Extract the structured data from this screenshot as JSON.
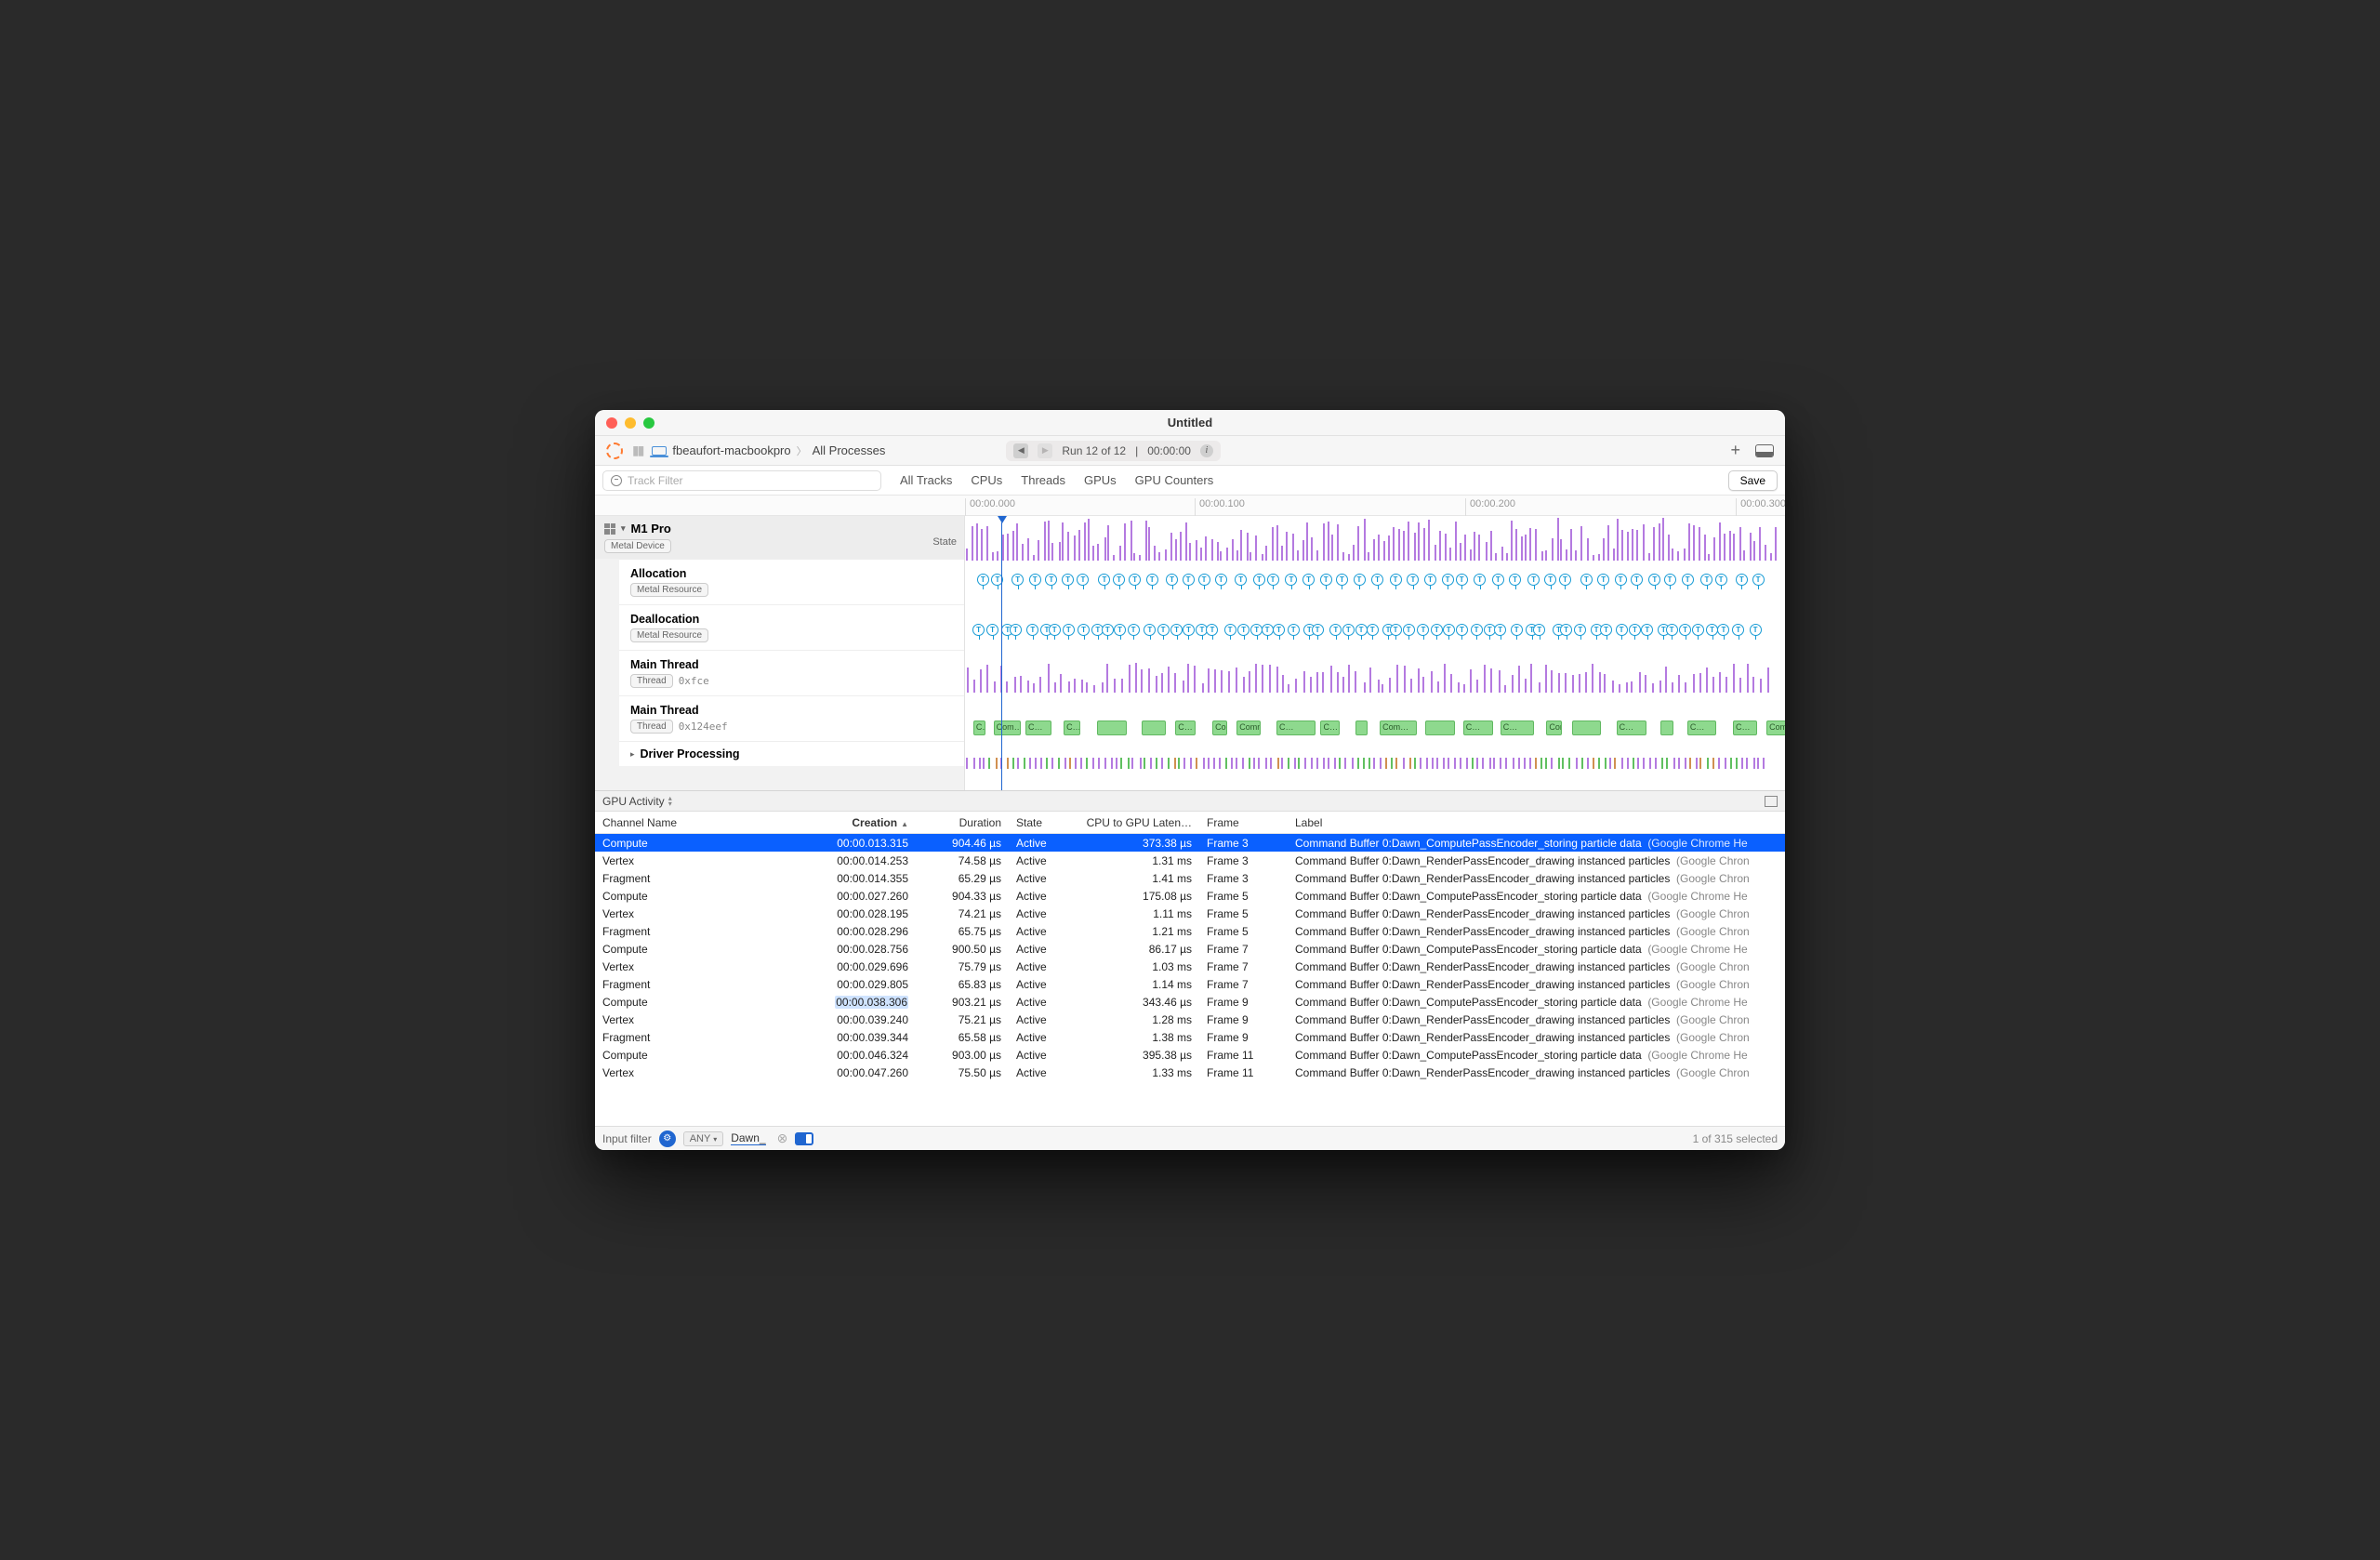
{
  "window": {
    "title": "Untitled"
  },
  "breadcrumb": {
    "host": "fbeaufort-macbookpro",
    "scope": "All Processes"
  },
  "run_pill": {
    "label": "Run 12 of 12",
    "time": "00:00:00"
  },
  "track_filter_placeholder": "Track Filter",
  "tabs": [
    "All Tracks",
    "CPUs",
    "Threads",
    "GPUs",
    "GPU Counters"
  ],
  "save_label": "Save",
  "ruler": [
    "00:00.000",
    "00:00.100",
    "00:00.200",
    "00:00.300"
  ],
  "sidebar": {
    "group": "M1 Pro",
    "group_badge": "Metal Device",
    "state_label": "State",
    "tracks": [
      {
        "name": "Allocation",
        "badge": "Metal Resource"
      },
      {
        "name": "Deallocation",
        "badge": "Metal Resource"
      },
      {
        "name": "Main Thread",
        "badge": "Thread",
        "meta": "0xfce"
      },
      {
        "name": "Main Thread",
        "badge": "Thread",
        "meta": "0x124eef"
      }
    ],
    "driver": "Driver Processing"
  },
  "section": "GPU Activity",
  "columns": {
    "channel": "Channel Name",
    "creation": "Creation",
    "duration": "Duration",
    "state": "State",
    "latency": "CPU to GPU Laten…",
    "frame": "Frame",
    "label": "Label"
  },
  "rows": [
    {
      "ch": "Compute",
      "cr": "00:00.013.315",
      "du": "904.46 µs",
      "st": "Active",
      "la": "373.38 µs",
      "fr": "Frame 3",
      "lb": "Command Buffer 0:Dawn_ComputePassEncoder_storing particle data",
      "app": "(Google Chrome He"
    },
    {
      "ch": "Vertex",
      "cr": "00:00.014.253",
      "du": "74.58 µs",
      "st": "Active",
      "la": "1.31 ms",
      "fr": "Frame 3",
      "lb": "Command Buffer 0:Dawn_RenderPassEncoder_drawing instanced particles",
      "app": "(Google Chron"
    },
    {
      "ch": "Fragment",
      "cr": "00:00.014.355",
      "du": "65.29 µs",
      "st": "Active",
      "la": "1.41 ms",
      "fr": "Frame 3",
      "lb": "Command Buffer 0:Dawn_RenderPassEncoder_drawing instanced particles",
      "app": "(Google Chron"
    },
    {
      "ch": "Compute",
      "cr": "00:00.027.260",
      "du": "904.33 µs",
      "st": "Active",
      "la": "175.08 µs",
      "fr": "Frame 5",
      "lb": "Command Buffer 0:Dawn_ComputePassEncoder_storing particle data",
      "app": "(Google Chrome He"
    },
    {
      "ch": "Vertex",
      "cr": "00:00.028.195",
      "du": "74.21 µs",
      "st": "Active",
      "la": "1.11 ms",
      "fr": "Frame 5",
      "lb": "Command Buffer 0:Dawn_RenderPassEncoder_drawing instanced particles",
      "app": "(Google Chron"
    },
    {
      "ch": "Fragment",
      "cr": "00:00.028.296",
      "du": "65.75 µs",
      "st": "Active",
      "la": "1.21 ms",
      "fr": "Frame 5",
      "lb": "Command Buffer 0:Dawn_RenderPassEncoder_drawing instanced particles",
      "app": "(Google Chron"
    },
    {
      "ch": "Compute",
      "cr": "00:00.028.756",
      "du": "900.50 µs",
      "st": "Active",
      "la": "86.17 µs",
      "fr": "Frame 7",
      "lb": "Command Buffer 0:Dawn_ComputePassEncoder_storing particle data",
      "app": "(Google Chrome He"
    },
    {
      "ch": "Vertex",
      "cr": "00:00.029.696",
      "du": "75.79 µs",
      "st": "Active",
      "la": "1.03 ms",
      "fr": "Frame 7",
      "lb": "Command Buffer 0:Dawn_RenderPassEncoder_drawing instanced particles",
      "app": "(Google Chron"
    },
    {
      "ch": "Fragment",
      "cr": "00:00.029.805",
      "du": "65.83 µs",
      "st": "Active",
      "la": "1.14 ms",
      "fr": "Frame 7",
      "lb": "Command Buffer 0:Dawn_RenderPassEncoder_drawing instanced particles",
      "app": "(Google Chron"
    },
    {
      "ch": "Compute",
      "cr": "00:00.038.306",
      "du": "903.21 µs",
      "st": "Active",
      "la": "343.46 µs",
      "fr": "Frame 9",
      "lb": "Command Buffer 0:Dawn_ComputePassEncoder_storing particle data",
      "app": "(Google Chrome He",
      "hl_cr": true
    },
    {
      "ch": "Vertex",
      "cr": "00:00.039.240",
      "du": "75.21 µs",
      "st": "Active",
      "la": "1.28 ms",
      "fr": "Frame 9",
      "lb": "Command Buffer 0:Dawn_RenderPassEncoder_drawing instanced particles",
      "app": "(Google Chron"
    },
    {
      "ch": "Fragment",
      "cr": "00:00.039.344",
      "du": "65.58 µs",
      "st": "Active",
      "la": "1.38 ms",
      "fr": "Frame 9",
      "lb": "Command Buffer 0:Dawn_RenderPassEncoder_drawing instanced particles",
      "app": "(Google Chron"
    },
    {
      "ch": "Compute",
      "cr": "00:00.046.324",
      "du": "903.00 µs",
      "st": "Active",
      "la": "395.38 µs",
      "fr": "Frame 11",
      "lb": "Command Buffer 0:Dawn_ComputePassEncoder_storing particle data",
      "app": "(Google Chrome He"
    },
    {
      "ch": "Vertex",
      "cr": "00:00.047.260",
      "du": "75.50 µs",
      "st": "Active",
      "la": "1.33 ms",
      "fr": "Frame 11",
      "lb": "Command Buffer 0:Dawn_RenderPassEncoder_drawing instanced particles",
      "app": "(Google Chron"
    }
  ],
  "footer": {
    "input_label": "Input filter",
    "any": "ANY",
    "filter_value": "Dawn_",
    "status": "1 of 315 selected"
  },
  "green_labels": [
    "C…",
    "Com…",
    "C…",
    "C…",
    "",
    "",
    "C…",
    "Com…",
    "Comm…",
    "C…",
    "C…",
    "",
    "Com…",
    "",
    "C…",
    "C…",
    "Com…",
    "",
    "C…",
    "",
    "C…",
    "C…",
    "Com…",
    "",
    "C…"
  ]
}
